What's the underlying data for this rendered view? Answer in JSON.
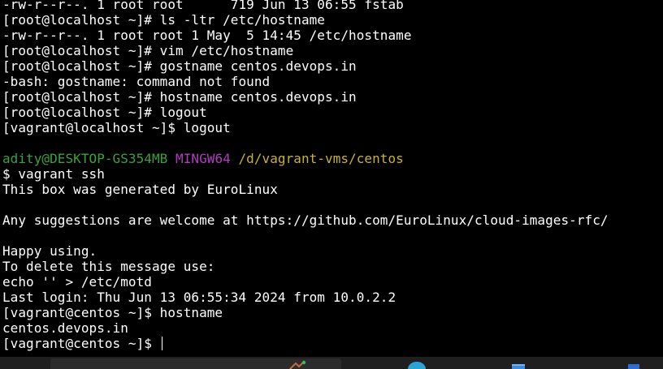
{
  "terminal": {
    "lines": [
      {
        "text": "-rw-r--r--. 1 root root      719 Jun 13 06:55 fstab"
      },
      {
        "text": "[root@localhost ~]# ls -ltr /etc/hostname"
      },
      {
        "text": "-rw-r--r--. 1 root root 1 May  5 14:45 /etc/hostname"
      },
      {
        "text": "[root@localhost ~]# vim /etc/hostname"
      },
      {
        "text": "[root@localhost ~]# gostname centos.devops.in"
      },
      {
        "text": "-bash: gostname: command not found"
      },
      {
        "text": "[root@localhost ~]# hostname centos.devops.in"
      },
      {
        "text": "[root@localhost ~]# logout"
      },
      {
        "text": "[vagrant@localhost ~]$ logout"
      },
      {
        "text": ""
      },
      {
        "segments": [
          {
            "text": "adity@DESKTOP-GS354MB",
            "style": "user"
          },
          {
            "text": " ",
            "style": "plain"
          },
          {
            "text": "MINGW64",
            "style": "env"
          },
          {
            "text": " ",
            "style": "plain"
          },
          {
            "text": "/d/vagrant-vms/centos",
            "style": "path"
          }
        ]
      },
      {
        "text": "$ vagrant ssh"
      },
      {
        "text": "This box was generated by EuroLinux"
      },
      {
        "text": ""
      },
      {
        "text": "Any suggestions are welcome at https://github.com/EuroLinux/cloud-images-rfc/"
      },
      {
        "text": ""
      },
      {
        "text": "Happy using."
      },
      {
        "text": "To delete this message use:"
      },
      {
        "text": "echo '' > /etc/motd"
      },
      {
        "text": "Last login: Thu Jun 13 06:55:34 2024 from 10.0.2.2"
      },
      {
        "text": "[vagrant@centos ~]$ hostname"
      },
      {
        "text": "centos.devops.in"
      },
      {
        "text": "[vagrant@centos ~]$ ",
        "cursor": true
      }
    ]
  },
  "colors": {
    "background": "#000000",
    "foreground": "#ffffff",
    "user": "#39a339",
    "env": "#b43cc0",
    "path": "#c9b22f",
    "taskbar": "#1f1f1f"
  },
  "taskbar": {
    "icons": [
      "search-box",
      "widget-icon",
      "app-icon",
      "app-icon",
      "app-icon"
    ]
  }
}
